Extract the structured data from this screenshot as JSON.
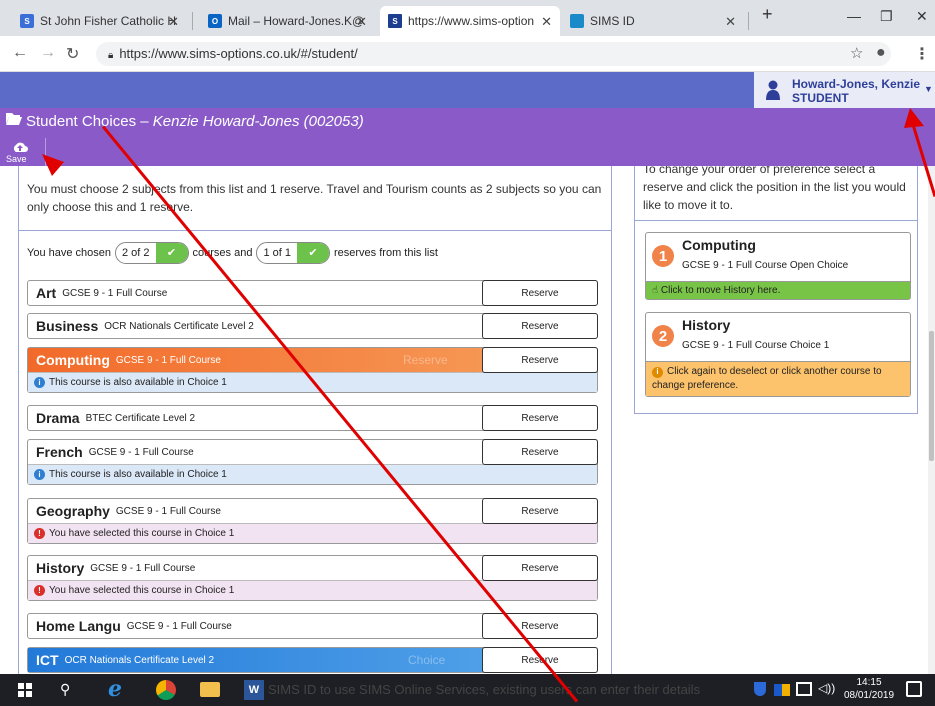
{
  "browser": {
    "tabs": [
      {
        "title": "St John Fisher Catholic H",
        "favicon": "sjf-icon"
      },
      {
        "title": "Mail – Howard-Jones.K@",
        "favicon": "outlook-icon"
      },
      {
        "title": "https://www.sims-option",
        "favicon": "sims-icon"
      },
      {
        "title": "SIMS ID",
        "favicon": "sims-id-icon"
      }
    ],
    "url": "https://www.sims-options.co.uk/#/student/"
  },
  "header": {
    "user_name": "Howard-Jones, Kenzie",
    "user_role": "STUDENT",
    "page_title": "Student Choices –",
    "student_name": "Kenzie Howard-Jones (002053)",
    "save_label": "Save"
  },
  "left": {
    "instructions": "You must choose 2 subjects from this list and 1 reserve. Travel and Tourism counts as 2 subjects so you can only choose this and 1 reserve.",
    "chosen_prefix": "You have chosen",
    "chosen_count": "2 of 2",
    "chosen_mid": "courses and",
    "reserve_count": "1 of 1",
    "chosen_suffix": "reserves from this list",
    "courses": [
      {
        "name": "Art",
        "desc": "GCSE 9 - 1 Full Course",
        "button": "Reserve"
      },
      {
        "name": "Business",
        "desc": "OCR Nationals Certificate Level 2",
        "button": "Reserve"
      },
      {
        "name": "Computing",
        "desc": "GCSE 9 - 1 Full Course",
        "button": "Reserve",
        "watermark": "Reserve",
        "note": "This course is also available in Choice 1"
      },
      {
        "name": "Drama",
        "desc": "BTEC Certificate Level 2",
        "button": "Reserve"
      },
      {
        "name": "French",
        "desc": "GCSE 9 - 1 Full Course",
        "button": "Reserve",
        "note": "This course is also available in Choice 1"
      },
      {
        "name": "Geography",
        "desc": "GCSE 9 - 1 Full Course",
        "button": "Reserve",
        "note": "You have selected this course in Choice 1"
      },
      {
        "name": "History",
        "desc": "GCSE 9 - 1 Full Course",
        "button": "Reserve",
        "note": "You have selected this course in Choice 1"
      },
      {
        "name": "Home Langu",
        "desc": "GCSE 9 - 1 Full Course",
        "button": "Reserve"
      },
      {
        "name": "ICT",
        "desc": "OCR Nationals Certificate Level 2",
        "button": "Reserve",
        "watermark": "Choice"
      }
    ]
  },
  "right": {
    "top_text_partial": "To change your order of preference select a",
    "instructions": "reserve and click the position in the list you would like to move it to.",
    "preferences": [
      {
        "rank": "1",
        "name": "Computing",
        "desc": "GCSE 9 - 1 Full Course Open Choice",
        "footer": "Click to move History here."
      },
      {
        "rank": "2",
        "name": "History",
        "desc": "GCSE 9 - 1 Full Course Choice 1",
        "footer": "Click again to deselect or click another course to change preference."
      }
    ]
  },
  "bottom_overlay_text": "SIMS ID to use SIMS Online Services, existing users can enter their details",
  "taskbar": {
    "time": "14:15",
    "date": "08/01/2019"
  },
  "colors": {
    "topbar": "#5b6bc7",
    "titlebar": "#8a5bc8",
    "selected_orange": "#f07a36",
    "selected_blue": "#2f8fe0",
    "success_green": "#6cc24a",
    "annotation_red": "#e00000"
  }
}
